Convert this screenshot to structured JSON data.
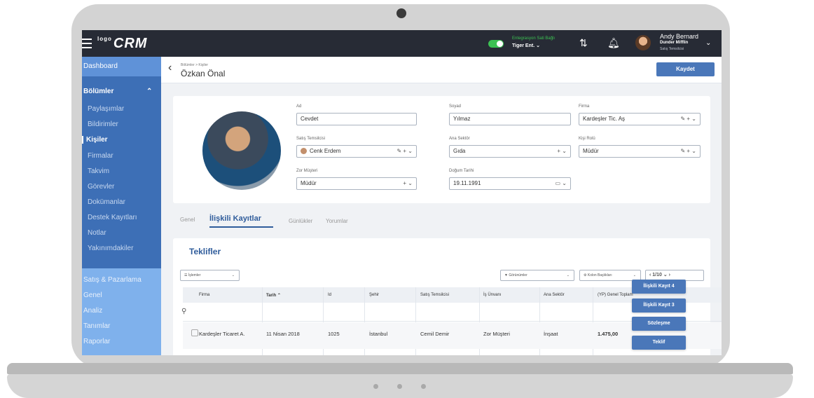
{
  "topbar": {
    "logo_prefix": "logo",
    "logo": "CRM",
    "integration_status": "Entegrasyon Sati Bağlı",
    "integration_company": "Tiger Ent.",
    "user_name": "Andy Bernard",
    "user_company": "Dunder Mifflin",
    "user_role": "Satış Temsilcisi",
    "toggle_color": "#3cc153"
  },
  "sidebar": {
    "dashboard": "Dashboard",
    "section_label": "Bölümler",
    "items": [
      "Paylaşımlar",
      "Bildirimler",
      "Kişiler",
      "Firmalar",
      "Takvim",
      "Görevler",
      "Dokümanlar",
      "Destek Kayıtları",
      "Notlar",
      "Yakınımdakiler"
    ],
    "lower_items": [
      "Satış & Pazarlama",
      "Genel",
      "Analiz",
      "Tanımlar",
      "Raporlar"
    ]
  },
  "header": {
    "breadcrumb": "Bölümler > Kişiler",
    "title": "Özkan Önal",
    "save_label": "Kaydet",
    "accent": "#4a77b9"
  },
  "form": {
    "ad_label": "Ad",
    "ad_value": "Cevdet",
    "soyad_label": "Soyad",
    "soyad_value": "Yılmaz",
    "firma_label": "Firma",
    "firma_value": "Kardeşler Tic. Aş",
    "satis_label": "Satış Temsilcisi",
    "satis_value": "Cenk Erdem",
    "sektor_label": "Ana Sektör",
    "sektor_value": "Gıda",
    "rol_label": "Kişi Rolü",
    "rol_value": "Müdür",
    "zor_label": "Zor Müşteri",
    "zor_value": "Müdür",
    "dogum_label": "Doğum Tarihi",
    "dogum_value": "19.11.1991"
  },
  "tabs": [
    "Genel",
    "İlişkili Kayıtlar",
    "Günlükler",
    "Yorumlar"
  ],
  "panel": {
    "title": "Teklifler",
    "islemler": "İşlemler",
    "gorunumler": "Görünümler",
    "kolon": "Kolon Başlıkları",
    "pager": "1/10"
  },
  "table": {
    "headers": [
      "Firma",
      "Tarih",
      "Id",
      "Şehir",
      "Satış Temsilcisi",
      "İş Ünvanı",
      "Ana Sektör",
      "(YP) Genel Toplam"
    ],
    "row": [
      "Kardeşler Ticaret A.",
      "11 Nisan 2018",
      "1025",
      "İstanbul",
      "Cemil Demir",
      "Zor Müşteri",
      "İnşaat",
      "1.475,00"
    ]
  },
  "actions": [
    "İlişkili Kayıt 4",
    "İlişkili Kayıt 3",
    "Sözleşme",
    "Teklif"
  ]
}
